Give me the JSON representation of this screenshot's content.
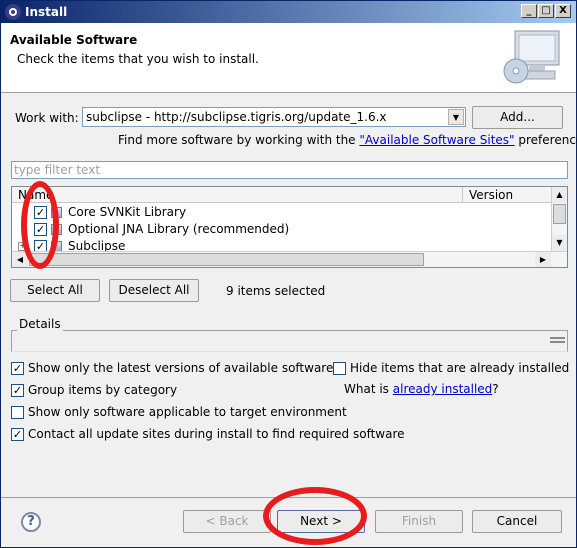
{
  "window": {
    "title": "Install",
    "controls": [
      "_",
      "□",
      "X"
    ]
  },
  "header": {
    "title": "Available Software",
    "description": "Check the items that you wish to install."
  },
  "work_with": {
    "label": "Work with:",
    "value": "subclipse - http://subclipse.tigris.org/update_1.6.x",
    "add_label": "Add...",
    "hint_prefix": "Find more software by working with the ",
    "hint_link": "\"Available Software Sites\"",
    "hint_suffix": " preferences."
  },
  "filter": {
    "placeholder": "type filter text"
  },
  "tree": {
    "columns": [
      "Name",
      "Version"
    ],
    "rows": [
      {
        "label": "Core SVNKit Library",
        "checked": "✓"
      },
      {
        "label": "Optional JNA Library (recommended)",
        "checked": "✓"
      },
      {
        "label": "Subclipse",
        "checked": "✓"
      }
    ]
  },
  "selection": {
    "select_all": "Select All",
    "deselect_all": "Deselect All",
    "status": "9 items selected"
  },
  "details": {
    "label": "Details"
  },
  "options": {
    "latest_only": {
      "label": "Show only the latest versions of available software",
      "checked": "✓"
    },
    "hide_installed": {
      "label": "Hide items that are already installed",
      "checked": ""
    },
    "group_by_category": {
      "label": "Group items by category",
      "checked": "✓"
    },
    "what_is_prefix": "What is ",
    "what_is_link": "already installed",
    "what_is_suffix": "?",
    "target_env": {
      "label": "Show only software applicable to target environment",
      "checked": ""
    },
    "contact_sites": {
      "label": "Contact all update sites during install to find required software",
      "checked": "✓"
    }
  },
  "footer": {
    "help": "?",
    "back": "< Back",
    "next": "Next >",
    "finish": "Finish",
    "cancel": "Cancel"
  },
  "colors": {
    "annotation_red": "#e81c1c",
    "title_bar": "#0a246a",
    "link": "#0000cc"
  }
}
